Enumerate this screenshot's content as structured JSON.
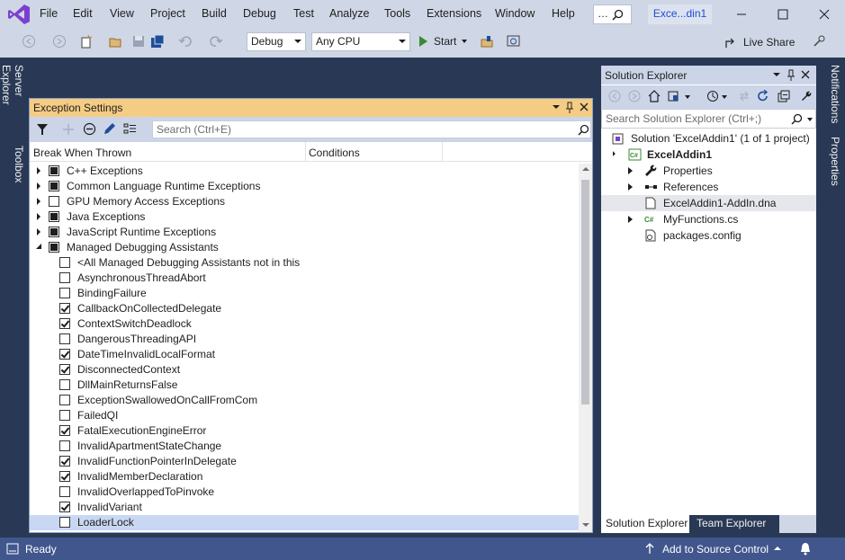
{
  "menu": [
    "File",
    "Edit",
    "View",
    "Project",
    "Build",
    "Debug",
    "Test",
    "Analyze",
    "Tools",
    "Extensions",
    "Window",
    "Help"
  ],
  "title_search_glyph": "…",
  "solution_badge": "Exce...din1",
  "toolbar": {
    "config": "Debug",
    "platform": "Any CPU",
    "start": "Start",
    "live_share": "Live Share"
  },
  "side_tabs": {
    "left": [
      "Server Explorer",
      "Toolbox"
    ],
    "right": [
      "Notifications",
      "Properties"
    ]
  },
  "exception_settings": {
    "title": "Exception Settings",
    "search_placeholder": "Search (Ctrl+E)",
    "columns": [
      "Break When Thrown",
      "Conditions"
    ],
    "rows": [
      {
        "label": "C++ Exceptions",
        "level": 0,
        "expander": "closed",
        "state": "full"
      },
      {
        "label": "Common Language Runtime Exceptions",
        "level": 0,
        "expander": "closed",
        "state": "full"
      },
      {
        "label": "GPU Memory Access Exceptions",
        "level": 0,
        "expander": "closed",
        "state": "empty"
      },
      {
        "label": "Java Exceptions",
        "level": 0,
        "expander": "closed",
        "state": "full"
      },
      {
        "label": "JavaScript Runtime Exceptions",
        "level": 0,
        "expander": "closed",
        "state": "full"
      },
      {
        "label": "Managed Debugging Assistants",
        "level": 0,
        "expander": "open",
        "state": "full"
      },
      {
        "label": "<All Managed Debugging Assistants not in this",
        "level": 1,
        "state": "empty"
      },
      {
        "label": "AsynchronousThreadAbort",
        "level": 1,
        "state": "empty"
      },
      {
        "label": "BindingFailure",
        "level": 1,
        "state": "empty"
      },
      {
        "label": "CallbackOnCollectedDelegate",
        "level": 1,
        "state": "checked"
      },
      {
        "label": "ContextSwitchDeadlock",
        "level": 1,
        "state": "checked"
      },
      {
        "label": "DangerousThreadingAPI",
        "level": 1,
        "state": "empty"
      },
      {
        "label": "DateTimeInvalidLocalFormat",
        "level": 1,
        "state": "checked"
      },
      {
        "label": "DisconnectedContext",
        "level": 1,
        "state": "checked"
      },
      {
        "label": "DllMainReturnsFalse",
        "level": 1,
        "state": "empty"
      },
      {
        "label": "ExceptionSwallowedOnCallFromCom",
        "level": 1,
        "state": "empty"
      },
      {
        "label": "FailedQI",
        "level": 1,
        "state": "empty"
      },
      {
        "label": "FatalExecutionEngineError",
        "level": 1,
        "state": "checked"
      },
      {
        "label": "InvalidApartmentStateChange",
        "level": 1,
        "state": "empty"
      },
      {
        "label": "InvalidFunctionPointerInDelegate",
        "level": 1,
        "state": "checked"
      },
      {
        "label": "InvalidMemberDeclaration",
        "level": 1,
        "state": "checked"
      },
      {
        "label": "InvalidOverlappedToPinvoke",
        "level": 1,
        "state": "empty"
      },
      {
        "label": "InvalidVariant",
        "level": 1,
        "state": "checked"
      },
      {
        "label": "LoaderLock",
        "level": 1,
        "state": "empty",
        "selected": true
      }
    ]
  },
  "solution_explorer": {
    "title": "Solution Explorer",
    "search_placeholder": "Search Solution Explorer (Ctrl+;)",
    "tree": [
      {
        "label": "Solution 'ExcelAddin1' (1 of 1 project)",
        "icon": "solution-icon"
      },
      {
        "label": "ExcelAddin1",
        "icon": "csharp-project-icon",
        "bold": true
      },
      {
        "label": "Properties",
        "icon": "wrench-icon"
      },
      {
        "label": "References",
        "icon": "references-icon"
      },
      {
        "label": "ExcelAddin1-AddIn.dna",
        "icon": "file-icon",
        "highlight": true
      },
      {
        "label": "MyFunctions.cs",
        "icon": "csharp-file-icon"
      },
      {
        "label": "packages.config",
        "icon": "config-file-icon"
      }
    ],
    "tabs": [
      "Solution Explorer",
      "Team Explorer"
    ]
  },
  "status": {
    "ready": "Ready",
    "source_control": "Add to Source Control"
  }
}
